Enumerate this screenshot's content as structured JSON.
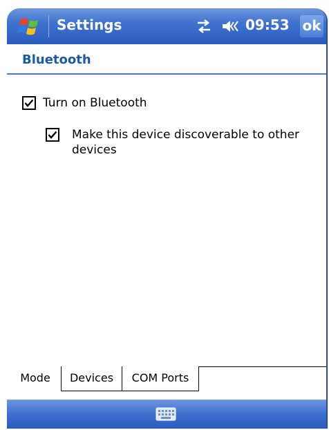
{
  "titlebar": {
    "app_title": "Settings",
    "clock": "09:53",
    "ok_label": "ok"
  },
  "header": {
    "title": "Bluetooth"
  },
  "options": [
    {
      "label": "Turn on Bluetooth",
      "checked": true
    },
    {
      "label_line1": "Make this device discoverable to other",
      "label_line2": "devices",
      "checked": true
    }
  ],
  "tabs": [
    {
      "label": "Mode",
      "active": true
    },
    {
      "label": "Devices",
      "active": false
    },
    {
      "label": "COM Ports",
      "active": false
    }
  ],
  "icons": {
    "start": "windows-flag-icon",
    "connectivity": "connectivity-arrows-icon",
    "volume": "speaker-muted-icon",
    "keyboard": "keyboard-icon"
  },
  "colors": {
    "titlebar": "#3f73cf",
    "header_text": "#1a5aa6",
    "header_line": "#4a7ec9"
  }
}
